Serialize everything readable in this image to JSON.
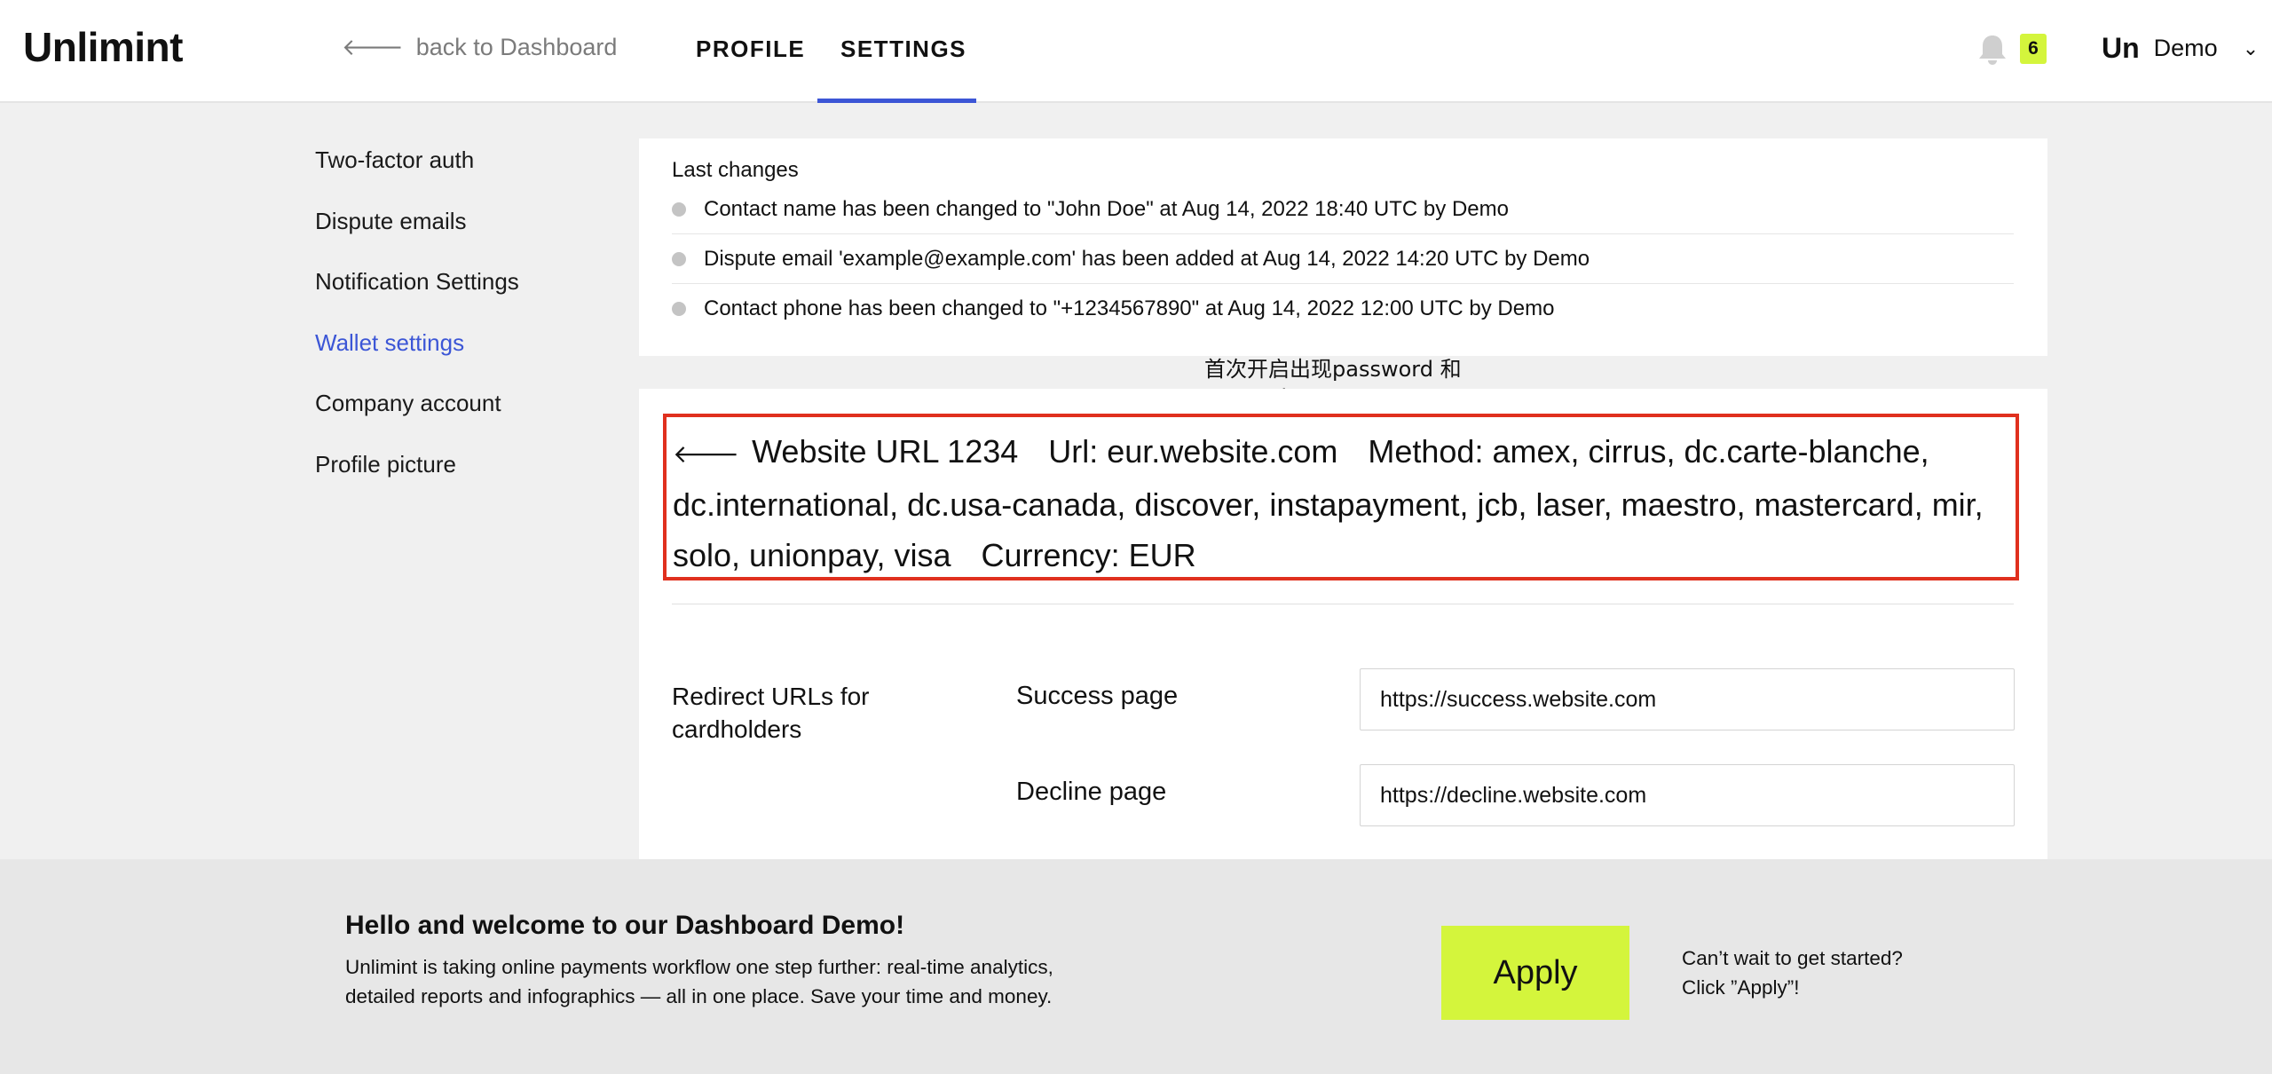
{
  "header": {
    "logo": "Unlimint",
    "back_label": "back to Dashboard",
    "tabs": [
      {
        "label": "PROFILE",
        "active": false
      },
      {
        "label": "SETTINGS",
        "active": true
      }
    ],
    "notifications_count": "6",
    "user_logo": "Un",
    "user_name": "Demo",
    "icons": {
      "back": "arrow-left-icon",
      "bell": "bell-icon",
      "chevron": "chevron-down-icon"
    }
  },
  "sidebar": {
    "items": [
      {
        "label": "Two-factor auth",
        "active": false
      },
      {
        "label": "Dispute emails",
        "active": false
      },
      {
        "label": "Notification Settings",
        "active": false
      },
      {
        "label": "Wallet settings",
        "active": true
      },
      {
        "label": "Company account",
        "active": false
      },
      {
        "label": "Profile picture",
        "active": false
      }
    ]
  },
  "last_changes": {
    "title": "Last changes",
    "items": [
      "Contact name has been changed to \"John Doe\" at Aug 14, 2022 18:40 UTC by Demo",
      "Dispute email 'example@example.com' has been added at Aug 14, 2022 14:20 UTC by Demo",
      "Contact phone has been changed to \"+1234567890\" at Aug 14, 2022 12:00 UTC by Demo"
    ]
  },
  "annotation": {
    "line1": "首次开启出现password 和",
    "line2": "secert_key"
  },
  "wallet": {
    "name": "Website URL 1234",
    "url": "Url: eur.website.com",
    "method": "Method: amex, cirrus, dc.carte-blanche, dc.international, dc.usa-canada, discover, instapayment, jcb, laser, maestro, mastercard, mir, solo, unionpay, visa",
    "currency": "Currency: EUR",
    "redirect_label": "Redirect URLs for cardholders",
    "success_label": "Success page",
    "success_value": "https://success.website.com",
    "decline_label": "Decline page",
    "decline_value": "https://decline.website.com"
  },
  "welcome": {
    "title": "Hello and welcome to our Dashboard Demo!",
    "text": "Unlimint is taking online payments workflow one step further: real-time analytics, detailed reports and infographics — all in one place. Save your time and money.",
    "apply_label": "Apply",
    "note_line1": "Can’t wait to get started?",
    "note_line2": "Click ”Apply”!"
  },
  "colors": {
    "accent": "#3c56d6",
    "lime": "#d4f53c",
    "highlight_border": "#e0301e",
    "background": "#f0f0f0"
  }
}
